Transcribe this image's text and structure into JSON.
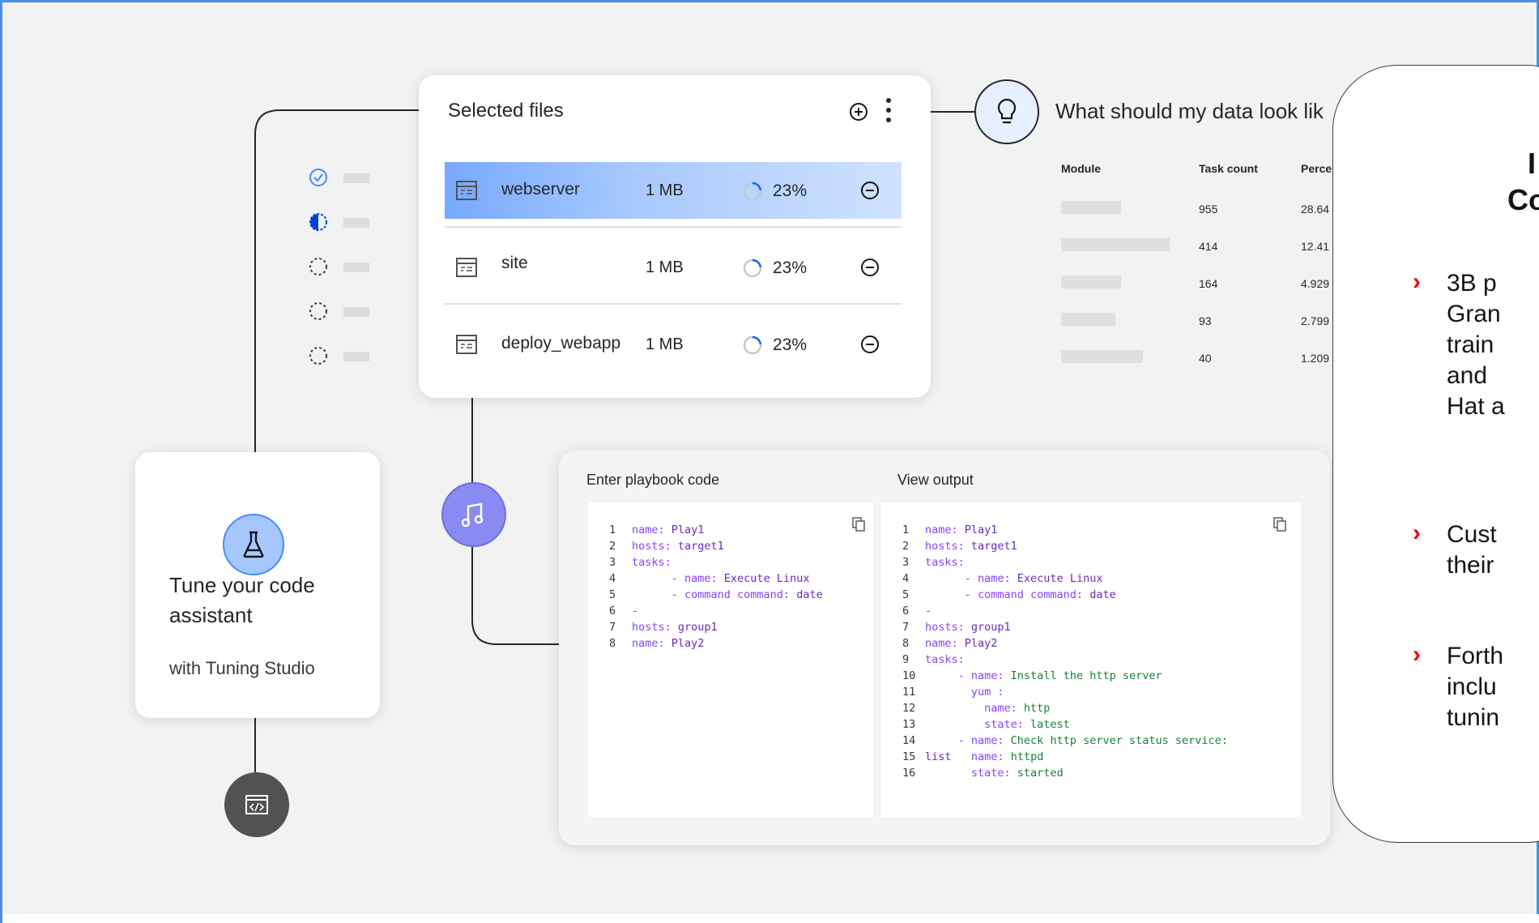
{
  "colors": {
    "accent_blue": "#4589ff",
    "selected_row": "#a6c8ff",
    "purple_node": "#8a8af2",
    "bullet_red": "#ee0000"
  },
  "files_card": {
    "title": "Selected files",
    "add_icon": "add-circle-icon",
    "more_icon": "overflow-menu-icon",
    "rows": [
      {
        "name": "webserver",
        "size": "1 MB",
        "progress": "23%",
        "progress_value": 0.23,
        "selected": true
      },
      {
        "name": "site",
        "size": "1 MB",
        "progress": "23%",
        "progress_value": 0.23,
        "selected": false
      },
      {
        "name": "deploy_webapp",
        "size": "1 MB",
        "progress": "23%",
        "progress_value": 0.23,
        "selected": false
      }
    ]
  },
  "status_list": {
    "items": [
      {
        "state": "complete",
        "icon": "checkmark-circle-icon"
      },
      {
        "state": "in-progress",
        "icon": "half-circle-icon"
      },
      {
        "state": "pending",
        "icon": "dashed-circle-icon"
      },
      {
        "state": "pending",
        "icon": "dashed-circle-icon"
      },
      {
        "state": "pending",
        "icon": "dashed-circle-icon"
      }
    ]
  },
  "tune_card": {
    "title_line1": "Tune your code",
    "title_line2": "assistant",
    "subtitle": "with Tuning Studio",
    "icon": "flask-icon"
  },
  "data_question": {
    "text": "What should my data look lik",
    "icon": "lightbulb-icon",
    "headers": [
      "Module",
      "Task count",
      "Perce"
    ],
    "rows": [
      {
        "task_count": "955",
        "percent": "28.64",
        "bar_value": 0.55
      },
      {
        "task_count": "414",
        "percent": "12.41",
        "bar_value": 1.0
      },
      {
        "task_count": "164",
        "percent": "4.929",
        "bar_value": 0.55
      },
      {
        "task_count": "93",
        "percent": "2.799",
        "bar_value": 0.5
      },
      {
        "task_count": "40",
        "percent": "1.209",
        "bar_value": 0.75
      }
    ]
  },
  "playbook": {
    "input_label": "Enter playbook code",
    "output_label": "View output",
    "copy_icon": "copy-icon",
    "input_lines": [
      {
        "n": "1",
        "parts": [
          {
            "c": "k",
            "t": "name: "
          },
          {
            "c": "v",
            "t": "Play1"
          }
        ]
      },
      {
        "n": "2",
        "parts": [
          {
            "c": "k",
            "t": "hosts: "
          },
          {
            "c": "v",
            "t": "target1"
          }
        ]
      },
      {
        "n": "3",
        "parts": [
          {
            "c": "k",
            "t": "tasks:"
          }
        ]
      },
      {
        "n": "4",
        "parts": [
          {
            "c": "k",
            "t": "      - name: "
          },
          {
            "c": "v",
            "t": "Execute Linux"
          }
        ]
      },
      {
        "n": "5",
        "parts": [
          {
            "c": "k",
            "t": "      - command command: "
          },
          {
            "c": "v",
            "t": "date"
          }
        ]
      },
      {
        "n": "6",
        "parts": [
          {
            "c": "k",
            "t": "-"
          }
        ]
      },
      {
        "n": "7",
        "parts": [
          {
            "c": "k",
            "t": "hosts: "
          },
          {
            "c": "v",
            "t": "group1"
          }
        ]
      },
      {
        "n": "8",
        "parts": [
          {
            "c": "k",
            "t": "name: "
          },
          {
            "c": "v",
            "t": "Play2"
          }
        ]
      }
    ],
    "output_lines": [
      {
        "n": "1",
        "parts": [
          {
            "c": "k",
            "t": "name: "
          },
          {
            "c": "v",
            "t": "Play1"
          }
        ]
      },
      {
        "n": "2",
        "parts": [
          {
            "c": "k",
            "t": "hosts: "
          },
          {
            "c": "v",
            "t": "target1"
          }
        ]
      },
      {
        "n": "3",
        "parts": [
          {
            "c": "k",
            "t": "tasks:"
          }
        ]
      },
      {
        "n": "4",
        "parts": [
          {
            "c": "k",
            "t": "      - name: "
          },
          {
            "c": "v",
            "t": "Execute Linux"
          }
        ]
      },
      {
        "n": "5",
        "parts": [
          {
            "c": "k",
            "t": "      - command command: "
          },
          {
            "c": "v",
            "t": "date"
          }
        ]
      },
      {
        "n": "6",
        "parts": [
          {
            "c": "k",
            "t": "-"
          }
        ]
      },
      {
        "n": "7",
        "parts": [
          {
            "c": "k",
            "t": "hosts: "
          },
          {
            "c": "v",
            "t": "group1"
          }
        ]
      },
      {
        "n": "8",
        "parts": [
          {
            "c": "k",
            "t": "name: "
          },
          {
            "c": "v",
            "t": "Play2"
          }
        ]
      },
      {
        "n": "9",
        "parts": [
          {
            "c": "k",
            "t": "tasks:"
          }
        ]
      },
      {
        "n": "10",
        "parts": [
          {
            "c": "k",
            "t": "     - name: "
          },
          {
            "c": "g",
            "t": "Install the http server"
          }
        ]
      },
      {
        "n": "11",
        "parts": [
          {
            "c": "k",
            "t": "       yum :"
          }
        ]
      },
      {
        "n": "12",
        "parts": [
          {
            "c": "k",
            "t": "         name: "
          },
          {
            "c": "g",
            "t": "http"
          }
        ]
      },
      {
        "n": "13",
        "parts": [
          {
            "c": "k",
            "t": "         state: "
          },
          {
            "c": "g",
            "t": "latest"
          }
        ]
      },
      {
        "n": "14",
        "parts": [
          {
            "c": "k",
            "t": "     - name: "
          },
          {
            "c": "g",
            "t": "Check http server status service:"
          }
        ]
      },
      {
        "n": "15",
        "parts": [
          {
            "c": "v",
            "t": "list  "
          },
          {
            "c": "k",
            "t": " name: "
          },
          {
            "c": "g",
            "t": "httpd"
          }
        ]
      },
      {
        "n": "16",
        "parts": [
          {
            "c": "k",
            "t": "       state: "
          },
          {
            "c": "g",
            "t": "started"
          }
        ]
      }
    ]
  },
  "callout": {
    "title_line1": "I",
    "title_line2": "Co",
    "bullets": [
      {
        "text": "3B p\nGran\ntrain\nand \nHat a"
      },
      {
        "text": "Cust\ntheir"
      },
      {
        "text": "Forth\ninclu\ntunin"
      }
    ]
  },
  "nodes": {
    "code_icon": "code-window-icon",
    "music_icon": "music-note-icon"
  }
}
